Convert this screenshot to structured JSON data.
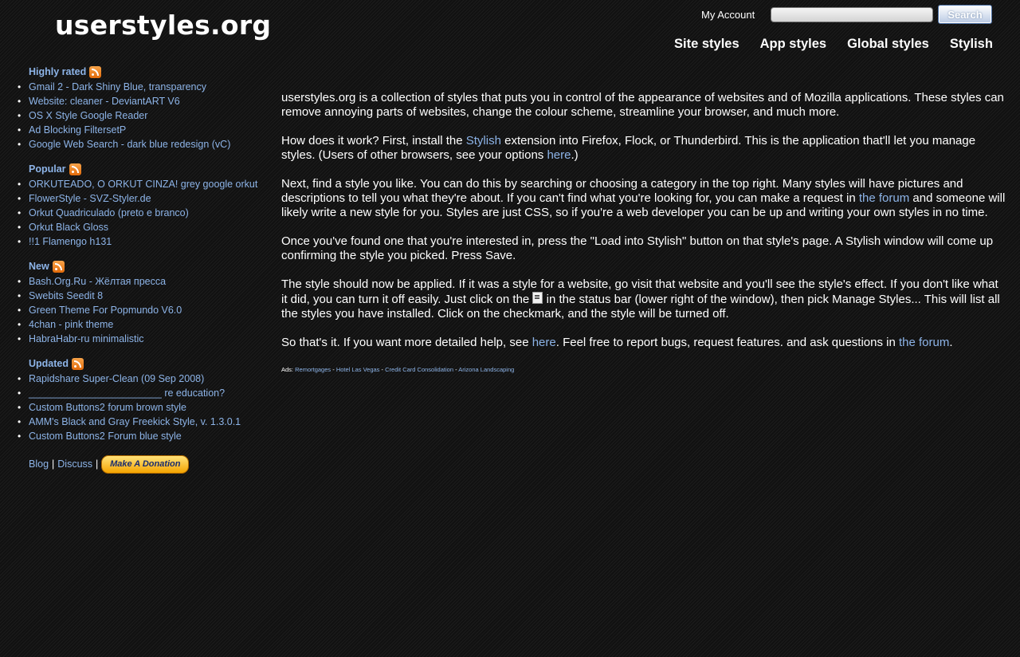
{
  "header": {
    "logo": "userstyles.org",
    "my_account": "My Account",
    "search_button": "Search",
    "search_value": "",
    "nav": [
      "Site styles",
      "App styles",
      "Global styles",
      "Stylish"
    ]
  },
  "sidebar": {
    "sections": [
      {
        "title": "Highly rated",
        "items": [
          "Gmail 2 - Dark Shiny Blue, transparency",
          "Website: cleaner - DeviantART V6",
          "OS X Style Google Reader",
          "Ad Blocking FiltersetP",
          "Google Web Search - dark blue redesign (vC)"
        ]
      },
      {
        "title": "Popular",
        "items": [
          "ORKUTEADO, O ORKUT CINZA! grey google orkut",
          "FlowerStyle - SVZ-Styler.de",
          "Orkut Quadriculado (preto e branco)",
          "Orkut Black Gloss",
          "!!1 Flamengo h131"
        ]
      },
      {
        "title": "New",
        "items": [
          "Bash.Org.Ru - Жёлтая пресса",
          "Swebits Seedit 8",
          "Green Theme For Popmundo V6.0",
          "4chan - pink theme",
          "HabraHabr-ru minimalistic"
        ]
      },
      {
        "title": "Updated",
        "items": [
          "Rapidshare Super-Clean (09 Sep 2008)",
          "________________________ re education?",
          "Custom Buttons2 forum brown style",
          "AMM's Black and Gray Freekick Style, v. 1.3.0.1",
          "Custom Buttons2 Forum blue style"
        ]
      }
    ],
    "footer": {
      "blog": "Blog",
      "discuss": "Discuss",
      "separator": "|",
      "donate": "Make A Donation"
    }
  },
  "main": {
    "p1": "userstyles.org is a collection of styles that puts you in control of the appearance of websites and of Mozilla applications. These styles can remove annoying parts of websites, change the colour scheme, streamline your browser, and much more.",
    "p2": {
      "a": "How does it work? First, install the ",
      "link1": "Stylish",
      "b": " extension into Firefox, Flock, or Thunderbird. This is the application that'll let you manage styles. (Users of other browsers, see your options ",
      "link2": "here",
      "c": ".)"
    },
    "p3": {
      "a": "Next, find a style you like. You can do this by searching or choosing a category in the top right. Many styles will have pictures and descriptions to tell you what they're about. If you can't find what you're looking for, you can make a request in ",
      "link": "the forum",
      "b": " and someone will likely write a new style for you. Styles are just CSS, so if you're a web developer you can be up and writing your own styles in no time."
    },
    "p4": "Once you've found one that you're interested in, press the \"Load into Stylish\" button on that style's page. A Stylish window will come up confirming the style you picked. Press Save.",
    "p5": {
      "a": "The style should now be applied. If it was a style for a website, go visit that website and you'll see the style's effect. If you don't like what it did, you can turn it off easily. Just click on the ",
      "b": " in the status bar (lower right of the window), then pick Manage Styles... This will list all the styles you have installed. Click on the checkmark, and the style will be turned off."
    },
    "p6": {
      "a": "So that's it. If you want more detailed help, see ",
      "link1": "here",
      "b": ". Feel free to report bugs, request features. and ask questions in ",
      "link2": "the forum",
      "c": "."
    },
    "ads": {
      "label": "Ads:",
      "links": [
        "Remortgages",
        "Hotel Las Vegas",
        "Credit Card Consolidation",
        "Arizona Landscaping"
      ],
      "sep": " - "
    }
  }
}
